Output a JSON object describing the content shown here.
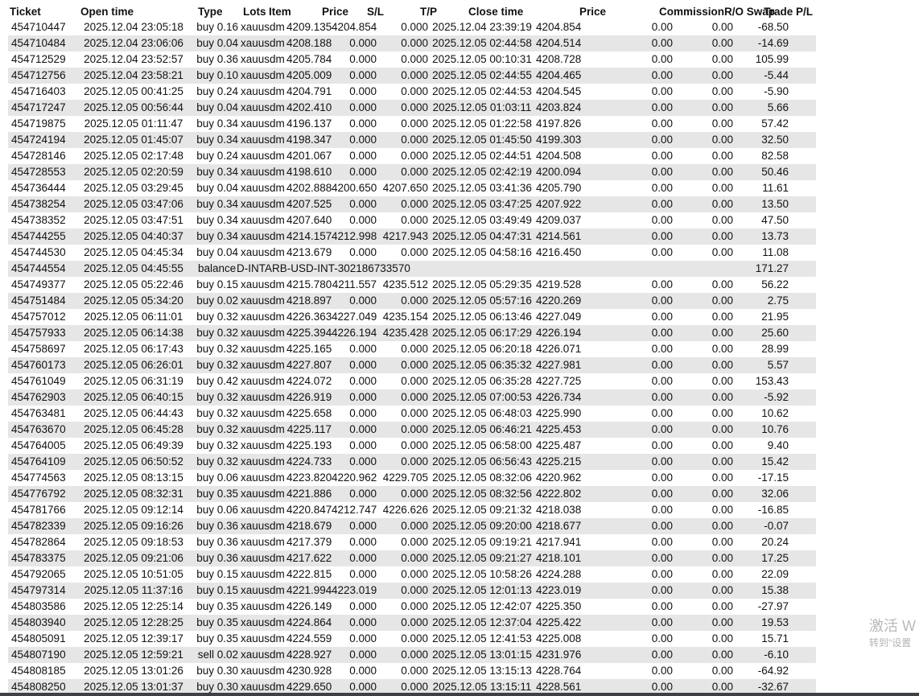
{
  "columns": {
    "ticket": "Ticket",
    "open_time": "Open time",
    "type": "Type",
    "lots": "Lots",
    "item": "Item",
    "price": "Price",
    "sl": "S/L",
    "tp": "T/P",
    "close_time": "Close time",
    "close_price": "Price",
    "commission": "Commission",
    "ro_swap": "R/O Swap",
    "trade_pl": "Trade P/L"
  },
  "rows": [
    [
      "454710447",
      "2025.12.04 23:05:18",
      "buy",
      "0.16",
      "xauusdm",
      "4209.135",
      "4204.854",
      "0.000",
      "2025.12.04 23:39:19",
      "4204.854",
      "0.00",
      "0.00",
      "-68.50"
    ],
    [
      "454710484",
      "2025.12.04 23:06:06",
      "buy",
      "0.04",
      "xauusdm",
      "4208.188",
      "0.000",
      "0.000",
      "2025.12.05 02:44:58",
      "4204.514",
      "0.00",
      "0.00",
      "-14.69"
    ],
    [
      "454712529",
      "2025.12.04 23:52:57",
      "buy",
      "0.36",
      "xauusdm",
      "4205.784",
      "0.000",
      "0.000",
      "2025.12.05 00:10:31",
      "4208.728",
      "0.00",
      "0.00",
      "105.99"
    ],
    [
      "454712756",
      "2025.12.04 23:58:21",
      "buy",
      "0.10",
      "xauusdm",
      "4205.009",
      "0.000",
      "0.000",
      "2025.12.05 02:44:55",
      "4204.465",
      "0.00",
      "0.00",
      "-5.44"
    ],
    [
      "454716403",
      "2025.12.05 00:41:25",
      "buy",
      "0.24",
      "xauusdm",
      "4204.791",
      "0.000",
      "0.000",
      "2025.12.05 02:44:53",
      "4204.545",
      "0.00",
      "0.00",
      "-5.90"
    ],
    [
      "454717247",
      "2025.12.05 00:56:44",
      "buy",
      "0.04",
      "xauusdm",
      "4202.410",
      "0.000",
      "0.000",
      "2025.12.05 01:03:11",
      "4203.824",
      "0.00",
      "0.00",
      "5.66"
    ],
    [
      "454719875",
      "2025.12.05 01:11:47",
      "buy",
      "0.34",
      "xauusdm",
      "4196.137",
      "0.000",
      "0.000",
      "2025.12.05 01:22:58",
      "4197.826",
      "0.00",
      "0.00",
      "57.42"
    ],
    [
      "454724194",
      "2025.12.05 01:45:07",
      "buy",
      "0.34",
      "xauusdm",
      "4198.347",
      "0.000",
      "0.000",
      "2025.12.05 01:45:50",
      "4199.303",
      "0.00",
      "0.00",
      "32.50"
    ],
    [
      "454728146",
      "2025.12.05 02:17:48",
      "buy",
      "0.24",
      "xauusdm",
      "4201.067",
      "0.000",
      "0.000",
      "2025.12.05 02:44:51",
      "4204.508",
      "0.00",
      "0.00",
      "82.58"
    ],
    [
      "454728553",
      "2025.12.05 02:20:59",
      "buy",
      "0.34",
      "xauusdm",
      "4198.610",
      "0.000",
      "0.000",
      "2025.12.05 02:42:19",
      "4200.094",
      "0.00",
      "0.00",
      "50.46"
    ],
    [
      "454736444",
      "2025.12.05 03:29:45",
      "buy",
      "0.04",
      "xauusdm",
      "4202.888",
      "4200.650",
      "4207.650",
      "2025.12.05 03:41:36",
      "4205.790",
      "0.00",
      "0.00",
      "11.61"
    ],
    [
      "454738254",
      "2025.12.05 03:47:06",
      "buy",
      "0.34",
      "xauusdm",
      "4207.525",
      "0.000",
      "0.000",
      "2025.12.05 03:47:25",
      "4207.922",
      "0.00",
      "0.00",
      "13.50"
    ],
    [
      "454738352",
      "2025.12.05 03:47:51",
      "buy",
      "0.34",
      "xauusdm",
      "4207.640",
      "0.000",
      "0.000",
      "2025.12.05 03:49:49",
      "4209.037",
      "0.00",
      "0.00",
      "47.50"
    ],
    [
      "454744255",
      "2025.12.05 04:40:37",
      "buy",
      "0.34",
      "xauusdm",
      "4214.157",
      "4212.998",
      "4217.943",
      "2025.12.05 04:47:31",
      "4214.561",
      "0.00",
      "0.00",
      "13.73"
    ],
    [
      "454744530",
      "2025.12.05 04:45:34",
      "buy",
      "0.04",
      "xauusdm",
      "4213.679",
      "0.000",
      "0.000",
      "2025.12.05 04:58:16",
      "4216.450",
      "0.00",
      "0.00",
      "11.08"
    ],
    {
      "balance": true,
      "ticket": "454744554",
      "time": "2025.12.05 04:45:55",
      "type": "balance",
      "desc": "D-INTARB-USD-INT-302186733570",
      "pl": "171.27"
    },
    [
      "454749377",
      "2025.12.05 05:22:46",
      "buy",
      "0.15",
      "xauusdm",
      "4215.780",
      "4211.557",
      "4235.512",
      "2025.12.05 05:29:35",
      "4219.528",
      "0.00",
      "0.00",
      "56.22"
    ],
    [
      "454751484",
      "2025.12.05 05:34:20",
      "buy",
      "0.02",
      "xauusdm",
      "4218.897",
      "0.000",
      "0.000",
      "2025.12.05 05:57:16",
      "4220.269",
      "0.00",
      "0.00",
      "2.75"
    ],
    [
      "454757012",
      "2025.12.05 06:11:01",
      "buy",
      "0.32",
      "xauusdm",
      "4226.363",
      "4227.049",
      "4235.154",
      "2025.12.05 06:13:46",
      "4227.049",
      "0.00",
      "0.00",
      "21.95"
    ],
    [
      "454757933",
      "2025.12.05 06:14:38",
      "buy",
      "0.32",
      "xauusdm",
      "4225.394",
      "4226.194",
      "4235.428",
      "2025.12.05 06:17:29",
      "4226.194",
      "0.00",
      "0.00",
      "25.60"
    ],
    [
      "454758697",
      "2025.12.05 06:17:43",
      "buy",
      "0.32",
      "xauusdm",
      "4225.165",
      "0.000",
      "0.000",
      "2025.12.05 06:20:18",
      "4226.071",
      "0.00",
      "0.00",
      "28.99"
    ],
    [
      "454760173",
      "2025.12.05 06:26:01",
      "buy",
      "0.32",
      "xauusdm",
      "4227.807",
      "0.000",
      "0.000",
      "2025.12.05 06:35:32",
      "4227.981",
      "0.00",
      "0.00",
      "5.57"
    ],
    [
      "454761049",
      "2025.12.05 06:31:19",
      "buy",
      "0.42",
      "xauusdm",
      "4224.072",
      "0.000",
      "0.000",
      "2025.12.05 06:35:28",
      "4227.725",
      "0.00",
      "0.00",
      "153.43"
    ],
    [
      "454762903",
      "2025.12.05 06:40:15",
      "buy",
      "0.32",
      "xauusdm",
      "4226.919",
      "0.000",
      "0.000",
      "2025.12.05 07:00:53",
      "4226.734",
      "0.00",
      "0.00",
      "-5.92"
    ],
    [
      "454763481",
      "2025.12.05 06:44:43",
      "buy",
      "0.32",
      "xauusdm",
      "4225.658",
      "0.000",
      "0.000",
      "2025.12.05 06:48:03",
      "4225.990",
      "0.00",
      "0.00",
      "10.62"
    ],
    [
      "454763670",
      "2025.12.05 06:45:28",
      "buy",
      "0.32",
      "xauusdm",
      "4225.117",
      "0.000",
      "0.000",
      "2025.12.05 06:46:21",
      "4225.453",
      "0.00",
      "0.00",
      "10.76"
    ],
    [
      "454764005",
      "2025.12.05 06:49:39",
      "buy",
      "0.32",
      "xauusdm",
      "4225.193",
      "0.000",
      "0.000",
      "2025.12.05 06:58:00",
      "4225.487",
      "0.00",
      "0.00",
      "9.40"
    ],
    [
      "454764109",
      "2025.12.05 06:50:52",
      "buy",
      "0.32",
      "xauusdm",
      "4224.733",
      "0.000",
      "0.000",
      "2025.12.05 06:56:43",
      "4225.215",
      "0.00",
      "0.00",
      "15.42"
    ],
    [
      "454774563",
      "2025.12.05 08:13:15",
      "buy",
      "0.06",
      "xauusdm",
      "4223.820",
      "4220.962",
      "4229.705",
      "2025.12.05 08:32:06",
      "4220.962",
      "0.00",
      "0.00",
      "-17.15"
    ],
    [
      "454776792",
      "2025.12.05 08:32:31",
      "buy",
      "0.35",
      "xauusdm",
      "4221.886",
      "0.000",
      "0.000",
      "2025.12.05 08:32:56",
      "4222.802",
      "0.00",
      "0.00",
      "32.06"
    ],
    [
      "454781766",
      "2025.12.05 09:12:14",
      "buy",
      "0.06",
      "xauusdm",
      "4220.847",
      "4212.747",
      "4226.626",
      "2025.12.05 09:21:32",
      "4218.038",
      "0.00",
      "0.00",
      "-16.85"
    ],
    [
      "454782339",
      "2025.12.05 09:16:26",
      "buy",
      "0.36",
      "xauusdm",
      "4218.679",
      "0.000",
      "0.000",
      "2025.12.05 09:20:00",
      "4218.677",
      "0.00",
      "0.00",
      "-0.07"
    ],
    [
      "454782864",
      "2025.12.05 09:18:53",
      "buy",
      "0.36",
      "xauusdm",
      "4217.379",
      "0.000",
      "0.000",
      "2025.12.05 09:19:21",
      "4217.941",
      "0.00",
      "0.00",
      "20.24"
    ],
    [
      "454783375",
      "2025.12.05 09:21:06",
      "buy",
      "0.36",
      "xauusdm",
      "4217.622",
      "0.000",
      "0.000",
      "2025.12.05 09:21:27",
      "4218.101",
      "0.00",
      "0.00",
      "17.25"
    ],
    [
      "454792065",
      "2025.12.05 10:51:05",
      "buy",
      "0.15",
      "xauusdm",
      "4222.815",
      "0.000",
      "0.000",
      "2025.12.05 10:58:26",
      "4224.288",
      "0.00",
      "0.00",
      "22.09"
    ],
    [
      "454797314",
      "2025.12.05 11:37:16",
      "buy",
      "0.15",
      "xauusdm",
      "4221.994",
      "4223.019",
      "0.000",
      "2025.12.05 12:01:13",
      "4223.019",
      "0.00",
      "0.00",
      "15.38"
    ],
    [
      "454803586",
      "2025.12.05 12:25:14",
      "buy",
      "0.35",
      "xauusdm",
      "4226.149",
      "0.000",
      "0.000",
      "2025.12.05 12:42:07",
      "4225.350",
      "0.00",
      "0.00",
      "-27.97"
    ],
    [
      "454803940",
      "2025.12.05 12:28:25",
      "buy",
      "0.35",
      "xauusdm",
      "4224.864",
      "0.000",
      "0.000",
      "2025.12.05 12:37:04",
      "4225.422",
      "0.00",
      "0.00",
      "19.53"
    ],
    [
      "454805091",
      "2025.12.05 12:39:17",
      "buy",
      "0.35",
      "xauusdm",
      "4224.559",
      "0.000",
      "0.000",
      "2025.12.05 12:41:53",
      "4225.008",
      "0.00",
      "0.00",
      "15.71"
    ],
    [
      "454807190",
      "2025.12.05 12:59:21",
      "sell",
      "0.02",
      "xauusdm",
      "4228.927",
      "0.000",
      "0.000",
      "2025.12.05 13:01:15",
      "4231.976",
      "0.00",
      "0.00",
      "-6.10"
    ],
    [
      "454808185",
      "2025.12.05 13:01:26",
      "buy",
      "0.30",
      "xauusdm",
      "4230.928",
      "0.000",
      "0.000",
      "2025.12.05 13:15:13",
      "4228.764",
      "0.00",
      "0.00",
      "-64.92"
    ],
    [
      "454808250",
      "2025.12.05 13:01:37",
      "buy",
      "0.30",
      "xauusdm",
      "4229.650",
      "0.000",
      "0.000",
      "2025.12.05 13:15:11",
      "4228.561",
      "0.00",
      "0.00",
      "-32.67"
    ]
  ],
  "watermark": {
    "line1": "激活 W",
    "line2": "转到\"设置"
  }
}
